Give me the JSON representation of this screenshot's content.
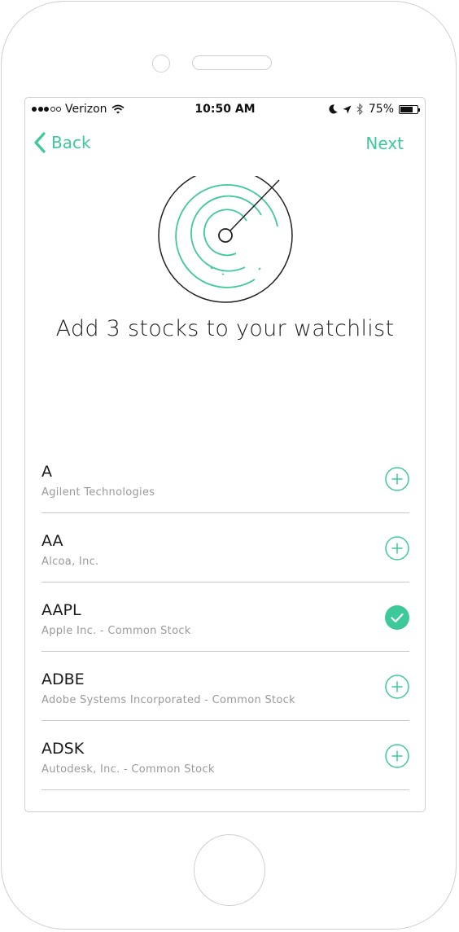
{
  "status_bar": {
    "carrier": "Verizon",
    "time": "10:50 AM",
    "battery": "75%",
    "battery_level": 0.75,
    "signal_bars": 3,
    "signal_max": 5,
    "icons": [
      "wifi-icon",
      "moon-icon",
      "location-arrow-icon",
      "bluetooth-icon",
      "battery-icon"
    ]
  },
  "nav": {
    "back_label": "Back",
    "next_label": "Next",
    "accent_color": "#3ec99a"
  },
  "headline": "Add 3 stocks to your watchlist",
  "stocks": [
    {
      "ticker": "A",
      "name": "Agilent Technologies",
      "added": false
    },
    {
      "ticker": "AA",
      "name": "Alcoa, Inc.",
      "added": false
    },
    {
      "ticker": "AAPL",
      "name": "Apple Inc. - Common Stock",
      "added": true
    },
    {
      "ticker": "ADBE",
      "name": "Adobe Systems Incorporated - Common Stock",
      "added": false
    },
    {
      "ticker": "ADSK",
      "name": "Autodesk, Inc. - Common Stock",
      "added": false
    }
  ]
}
